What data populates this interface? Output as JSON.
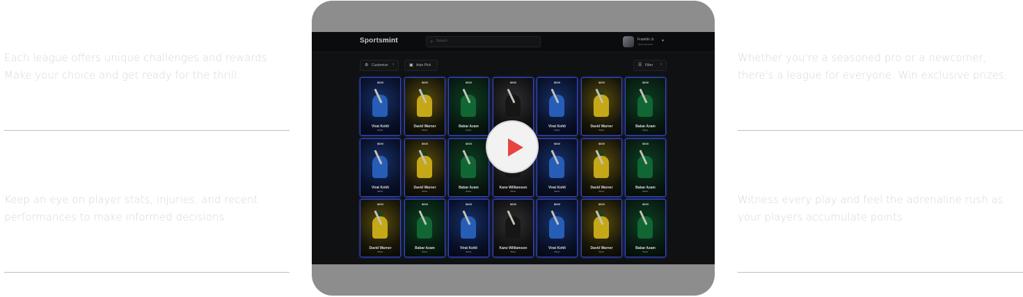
{
  "left_panel": {
    "items": [
      "Each league offers unique challenges and rewards. Make your choice and get ready for the thrill.",
      "Keep an eye on player stats, injuries, and recent performances to make informed decisions."
    ]
  },
  "right_panel": {
    "items": [
      "Whether you're a seasoned pro or a newcomer, there's a league for everyone. Win exclusive prizes.",
      "Witness every play and feel the adrenaline rush as your players accumulate points."
    ]
  },
  "video": {
    "app": {
      "logo_prefix": "Sports",
      "logo_suffix": "mint",
      "search_placeholder": "Search",
      "user_name": "Franklin Jr.",
      "user_role": "Team Admin",
      "customize_label": "Customize",
      "auto_pick_label": "Auto Pick",
      "filter_label": "Filter"
    },
    "cards": [
      [
        {
          "name": "Virat Kohli",
          "team": "india",
          "price": "$600",
          "role": "Batter"
        },
        {
          "name": "David Warner",
          "team": "aus",
          "price": "$600",
          "role": "Batter"
        },
        {
          "name": "Babar Azam",
          "team": "pak",
          "price": "$600",
          "role": "Batter"
        },
        {
          "name": "Kane Williamson",
          "team": "nz",
          "price": "$600",
          "role": "Batter"
        },
        {
          "name": "Virat Kohli",
          "team": "india",
          "price": "$600",
          "role": "Batter"
        },
        {
          "name": "David Warner",
          "team": "aus",
          "price": "$600",
          "role": "Batter"
        },
        {
          "name": "Babar Azam",
          "team": "pak",
          "price": "$600",
          "role": "Batter"
        }
      ],
      [
        {
          "name": "Virat Kohli",
          "team": "india",
          "price": "$600",
          "role": "Batter"
        },
        {
          "name": "David Warner",
          "team": "aus",
          "price": "$600",
          "role": "Batter"
        },
        {
          "name": "Babar Azam",
          "team": "pak",
          "price": "$600",
          "role": "Batter"
        },
        {
          "name": "Kane Williamson",
          "team": "nz",
          "price": "$600",
          "role": "Batter"
        },
        {
          "name": "Virat Kohli",
          "team": "india",
          "price": "$600",
          "role": "Batter"
        },
        {
          "name": "David Warner",
          "team": "aus",
          "price": "$600",
          "role": "Batter"
        },
        {
          "name": "Babar Azam",
          "team": "pak",
          "price": "$600",
          "role": "Batter"
        }
      ],
      [
        {
          "name": "David Warner",
          "team": "aus",
          "price": "$600",
          "role": "Batter"
        },
        {
          "name": "Babar Azam",
          "team": "pak",
          "price": "$600",
          "role": "Batter"
        },
        {
          "name": "Virat Kohli",
          "team": "india",
          "price": "$600",
          "role": "Batter"
        },
        {
          "name": "Kane Williamson",
          "team": "nz",
          "price": "$600",
          "role": "Batter"
        },
        {
          "name": "Virat Kohli",
          "team": "india",
          "price": "$600",
          "role": "Batter"
        },
        {
          "name": "David Warner",
          "team": "aus",
          "price": "$600",
          "role": "Batter"
        },
        {
          "name": "Babar Azam",
          "team": "pak",
          "price": "$600",
          "role": "Batter"
        }
      ]
    ]
  },
  "colors": {
    "card_border": "#3d56ff",
    "play_icon": "#e8443e",
    "frame": "#a6a6a6",
    "screen_bg": "#131416"
  }
}
